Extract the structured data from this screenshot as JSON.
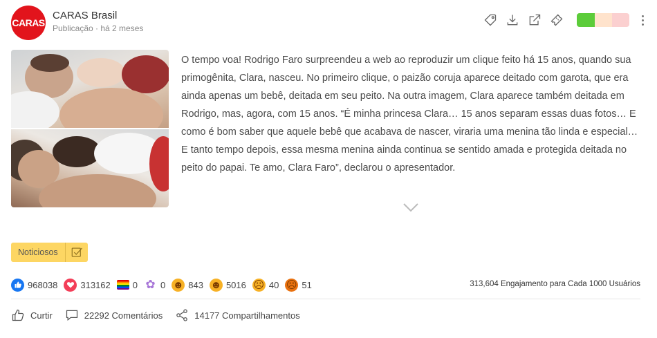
{
  "header": {
    "avatar_text": "CARAS",
    "page_name": "CARAS Brasil",
    "post_meta": "Publicação · há 2 meses"
  },
  "toolbar": {
    "icons": [
      "tag-icon",
      "download-icon",
      "external-link-icon",
      "ticket-icon"
    ],
    "sentiment": {
      "segments": [
        {
          "color": "#5ccc3a",
          "share": 0.34
        },
        {
          "color": "#ffe3cc",
          "share": 0.33
        },
        {
          "color": "#fbd0d0",
          "share": 0.33
        }
      ]
    }
  },
  "post": {
    "text": "O tempo voa! Rodrigo Faro surpreendeu a web ao reproduzir um clique feito há 15 anos, quando sua primogênita, Clara, nasceu. No primeiro clique, o paizão coruja aparece deitado com garota, que era ainda apenas um bebê, deitada em seu peito. Na outra imagem, Clara aparece também deitada em Rodrigo, mas, agora, com 15 anos. “É minha princesa Clara… 15 anos separam essas duas fotos… E como é bom saber que aquele bebê que acabava de nascer, viraria uma menina tão linda e especial…E tanto tempo depois, essa mesma menina ainda continua se sentido amada e protegida deitada no peito do papai. Te amo, Clara Faro”, declarou o apresentador."
  },
  "tag": {
    "label": "Noticiosos"
  },
  "reactions": [
    {
      "name": "like",
      "icon": "thumbs-up-icon",
      "color": "#1877f2",
      "count": "968038"
    },
    {
      "name": "love",
      "icon": "heart-icon",
      "color": "#f33e58",
      "count": "313162"
    },
    {
      "name": "pride",
      "icon": "rainbow-flag-icon",
      "color": "#ffffff",
      "count": "0"
    },
    {
      "name": "thankful",
      "icon": "flower-icon",
      "color": "#a877d8",
      "count": "0"
    },
    {
      "name": "haha",
      "icon": "laughing-face-icon",
      "color": "#f7b125",
      "count": "843"
    },
    {
      "name": "wow",
      "icon": "surprised-face-icon",
      "color": "#f7b125",
      "count": "5016"
    },
    {
      "name": "sad",
      "icon": "sad-face-icon",
      "color": "#f7b125",
      "count": "40"
    },
    {
      "name": "angry",
      "icon": "angry-face-icon",
      "color": "#e9710f",
      "count": "51"
    }
  ],
  "engagement": {
    "value": "313,604",
    "label": "Engajamento para Cada 1000 Usuários"
  },
  "actions": {
    "like_label": "Curtir",
    "comments_label": "22292 Comentários",
    "shares_label": "14177 Compartilhamentos"
  }
}
